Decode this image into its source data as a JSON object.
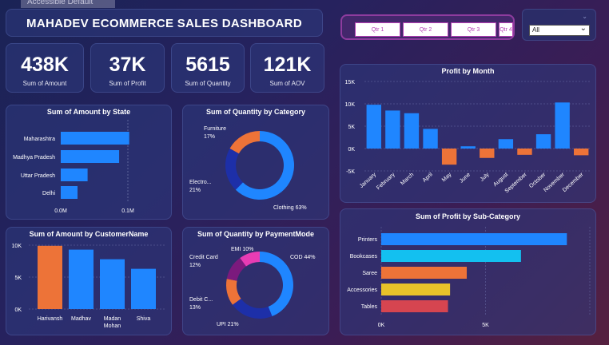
{
  "header": {
    "title": "MAHADEV ECOMMERCE SALES DASHBOARD",
    "faded_tag": "Accessible Default"
  },
  "slicers": {
    "quarters": [
      "Qtr 1",
      "Qtr 2",
      "Qtr 3",
      "Qtr 4"
    ],
    "dropdown_value": "All"
  },
  "kpis": [
    {
      "value": "438K",
      "label": "Sum of Amount"
    },
    {
      "value": "37K",
      "label": "Sum of Profit"
    },
    {
      "value": "5615",
      "label": "Sum of Quantity"
    },
    {
      "value": "121K",
      "label": "Sum of AOV"
    }
  ],
  "colors": {
    "blue": "#1f86ff",
    "orange": "#ed7338",
    "navy": "#1d2fa8",
    "cyan": "#13c0f0",
    "yellow": "#e8c22a",
    "red": "#d64550",
    "purple": "#7b1a7d",
    "pink": "#e83cb4"
  },
  "chart_data": [
    {
      "id": "amount_by_state",
      "type": "bar",
      "orientation": "horizontal",
      "title": "Sum of Amount by State",
      "categories": [
        "Maharashtra",
        "Madhya Pradesh",
        "Uttar Pradesh",
        "Delhi"
      ],
      "values": [
        0.102,
        0.087,
        0.04,
        0.025
      ],
      "tick_labels": [
        "0.0M",
        "0.1M"
      ],
      "xlim": [
        0,
        0.1
      ]
    },
    {
      "id": "quantity_by_category",
      "type": "pie",
      "title": "Sum of Quantity by Category",
      "categories": [
        "Clothing",
        "Electronics",
        "Furniture"
      ],
      "label_text": [
        "Clothing 63%",
        "Electro...\n21%",
        "Furniture\n17%"
      ],
      "values": [
        63,
        21,
        17
      ]
    },
    {
      "id": "profit_by_month",
      "type": "bar",
      "title": "Profit by Month",
      "categories": [
        "January",
        "February",
        "March",
        "April",
        "May",
        "June",
        "July",
        "August",
        "September",
        "October",
        "November",
        "December"
      ],
      "values": [
        9800,
        8500,
        7900,
        4400,
        -3600,
        500,
        -2100,
        2100,
        -1400,
        3200,
        10300,
        -1500
      ],
      "tick_labels": [
        "15K",
        "10K",
        "5K",
        "0K",
        "-5K"
      ],
      "ylim": [
        -5000,
        15000
      ]
    },
    {
      "id": "amount_by_customer",
      "type": "bar",
      "title": "Sum of Amount by CustomerName",
      "categories": [
        "Harivansh",
        "Madhav",
        "Madan Mohan",
        "Shiva"
      ],
      "category_labels": [
        [
          "Harivansh"
        ],
        [
          "Madhav"
        ],
        [
          "Madan",
          "Mohan"
        ],
        [
          "Shiva"
        ]
      ],
      "values": [
        9900,
        9300,
        7800,
        6300
      ],
      "tick_labels": [
        "10K",
        "5K",
        "0K"
      ],
      "ylim": [
        0,
        10000
      ]
    },
    {
      "id": "quantity_by_payment",
      "type": "pie",
      "title": "Sum of Quantity by PaymentMode",
      "categories": [
        "COD",
        "UPI",
        "Debit Card",
        "Credit Card",
        "EMI"
      ],
      "label_text": [
        "COD 44%",
        "UPI 21%",
        "Debit C...\n13%",
        "Credit Card\n12%",
        "EMI 10%"
      ],
      "values": [
        44,
        21,
        13,
        12,
        10
      ]
    },
    {
      "id": "profit_by_subcategory",
      "type": "bar",
      "orientation": "horizontal",
      "title": "Sum of Profit by Sub-Category",
      "categories": [
        "Printers",
        "Bookcases",
        "Saree",
        "Accessories",
        "Tables"
      ],
      "values": [
        8900,
        6700,
        4100,
        3300,
        3200
      ],
      "tick_labels": [
        "0K",
        "5K"
      ],
      "xlim": [
        0,
        10000
      ]
    }
  ]
}
